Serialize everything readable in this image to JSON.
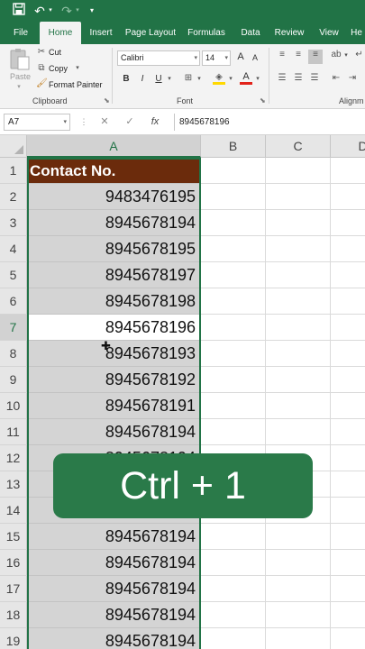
{
  "quick_access": {
    "save_icon": "save-icon",
    "undo_icon": "undo-icon",
    "redo_icon": "redo-icon",
    "customize_icon": "customize-icon"
  },
  "tabs": [
    "File",
    "Home",
    "Insert",
    "Page Layout",
    "Formulas",
    "Data",
    "Review",
    "View",
    "He"
  ],
  "active_tab": "Home",
  "clipboard": {
    "paste_label": "Paste",
    "cut_label": "Cut",
    "copy_label": "Copy",
    "format_painter_label": "Format Painter",
    "group_label": "Clipboard"
  },
  "font": {
    "name": "Calibri",
    "size": "14",
    "bold": "B",
    "italic": "I",
    "underline": "U",
    "grow": "A",
    "shrink": "A",
    "font_color_icon": "A",
    "group_label": "Font"
  },
  "alignment": {
    "group_label": "Alignm"
  },
  "formula_bar": {
    "name_box": "A7",
    "cancel_icon": "✕",
    "enter_icon": "✓",
    "fx": "fx",
    "value": "8945678196"
  },
  "columns": [
    "A",
    "B",
    "C",
    "D"
  ],
  "selected_column": "A",
  "rows": [
    "1",
    "2",
    "3",
    "4",
    "5",
    "6",
    "7",
    "8",
    "9",
    "10",
    "11",
    "12",
    "13",
    "14",
    "15",
    "16",
    "17",
    "18",
    "19"
  ],
  "active_row": "7",
  "cells_a": [
    "Contact No.",
    "9483476195",
    "8945678194",
    "8945678195",
    "8945678197",
    "8945678198",
    "8945678196",
    "8945678193",
    "8945678192",
    "8945678191",
    "8945678194",
    "8945678194",
    "",
    "",
    "8945678194",
    "8945678194",
    "8945678194",
    "8945678194",
    "8945678194"
  ],
  "overlay_text": "Ctrl + 1",
  "colors": {
    "excel_green": "#217346",
    "header_fill": "#6b2b0c",
    "selection_fill": "#d4d4d4",
    "overlay_bg": "#2a7a49"
  }
}
